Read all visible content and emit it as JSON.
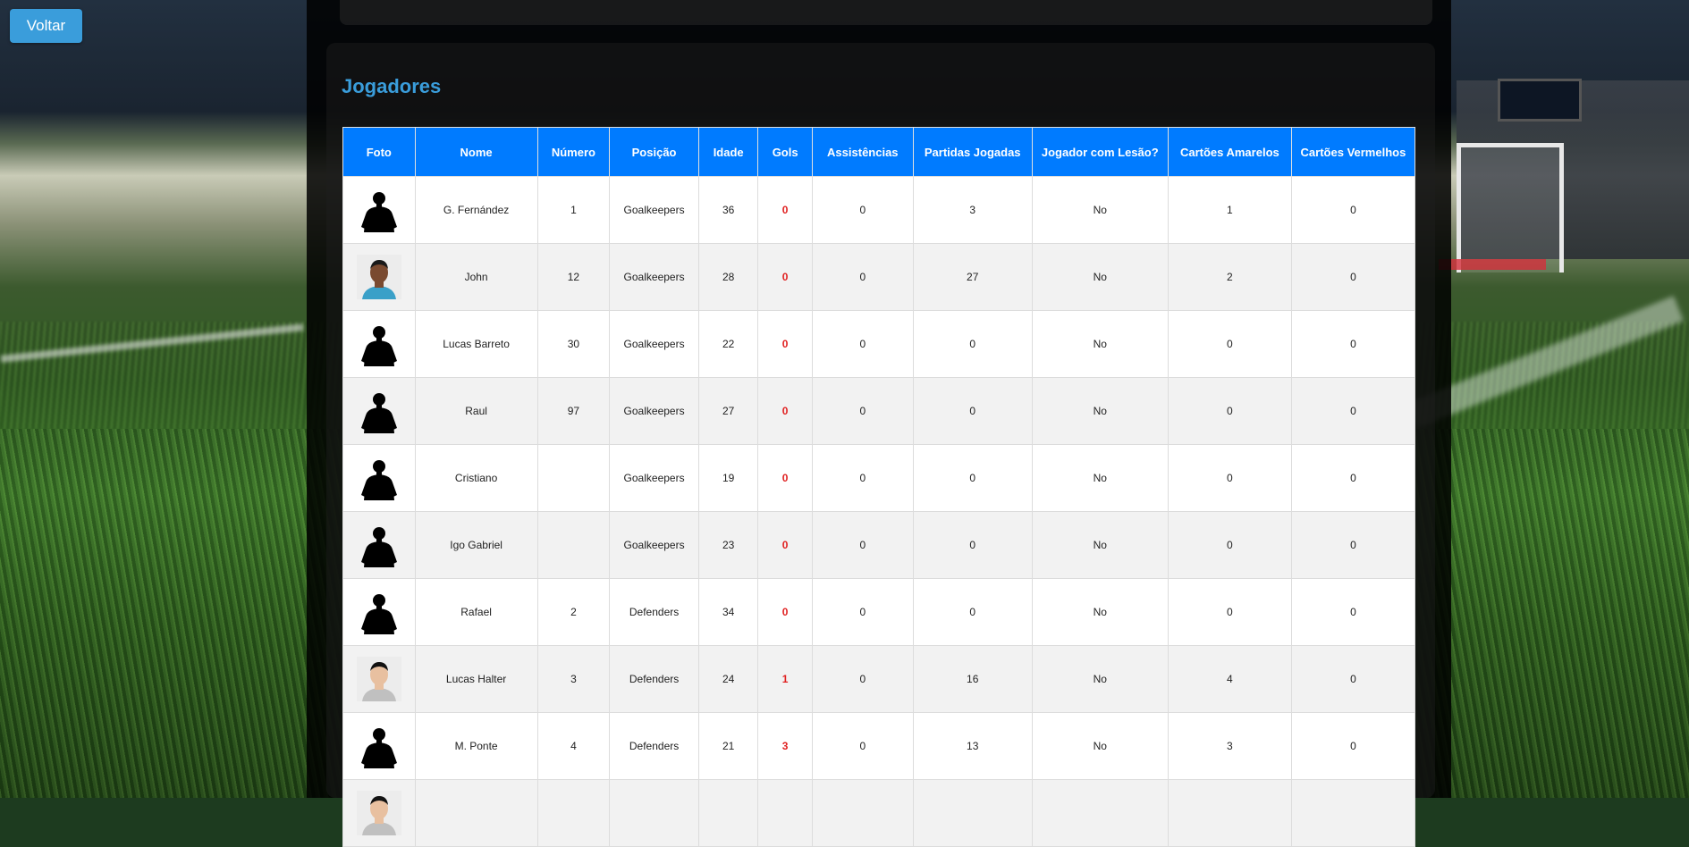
{
  "nav": {
    "back_label": "Voltar"
  },
  "page": {
    "title": "Jogadores"
  },
  "table": {
    "headers": {
      "foto": "Foto",
      "nome": "Nome",
      "numero": "Número",
      "posicao": "Posição",
      "idade": "Idade",
      "gols": "Gols",
      "assistencias": "Assistências",
      "partidas": "Partidas Jogadas",
      "lesao": "Jogador com Lesão?",
      "amarelos": "Cartões Amarelos",
      "vermelhos": "Cartões Vermelhos"
    },
    "rows": [
      {
        "photo": "silhouette",
        "nome": "G. Fernández",
        "numero": "1",
        "posicao": "Goalkeepers",
        "idade": "36",
        "gols": "0",
        "assistencias": "0",
        "partidas": "3",
        "lesao": "No",
        "amarelos": "1",
        "vermelhos": "0"
      },
      {
        "photo": "portrait-dark",
        "nome": "John",
        "numero": "12",
        "posicao": "Goalkeepers",
        "idade": "28",
        "gols": "0",
        "assistencias": "0",
        "partidas": "27",
        "lesao": "No",
        "amarelos": "2",
        "vermelhos": "0"
      },
      {
        "photo": "silhouette",
        "nome": "Lucas Barreto",
        "numero": "30",
        "posicao": "Goalkeepers",
        "idade": "22",
        "gols": "0",
        "assistencias": "0",
        "partidas": "0",
        "lesao": "No",
        "amarelos": "0",
        "vermelhos": "0"
      },
      {
        "photo": "silhouette",
        "nome": "Raul",
        "numero": "97",
        "posicao": "Goalkeepers",
        "idade": "27",
        "gols": "0",
        "assistencias": "0",
        "partidas": "0",
        "lesao": "No",
        "amarelos": "0",
        "vermelhos": "0"
      },
      {
        "photo": "silhouette",
        "nome": "Cristiano",
        "numero": "",
        "posicao": "Goalkeepers",
        "idade": "19",
        "gols": "0",
        "assistencias": "0",
        "partidas": "0",
        "lesao": "No",
        "amarelos": "0",
        "vermelhos": "0"
      },
      {
        "photo": "silhouette",
        "nome": "Igo Gabriel",
        "numero": "",
        "posicao": "Goalkeepers",
        "idade": "23",
        "gols": "0",
        "assistencias": "0",
        "partidas": "0",
        "lesao": "No",
        "amarelos": "0",
        "vermelhos": "0"
      },
      {
        "photo": "silhouette",
        "nome": "Rafael",
        "numero": "2",
        "posicao": "Defenders",
        "idade": "34",
        "gols": "0",
        "assistencias": "0",
        "partidas": "0",
        "lesao": "No",
        "amarelos": "0",
        "vermelhos": "0"
      },
      {
        "photo": "portrait-light",
        "nome": "Lucas Halter",
        "numero": "3",
        "posicao": "Defenders",
        "idade": "24",
        "gols": "1",
        "assistencias": "0",
        "partidas": "16",
        "lesao": "No",
        "amarelos": "4",
        "vermelhos": "0"
      },
      {
        "photo": "silhouette",
        "nome": "M. Ponte",
        "numero": "4",
        "posicao": "Defenders",
        "idade": "21",
        "gols": "3",
        "assistencias": "0",
        "partidas": "13",
        "lesao": "No",
        "amarelos": "3",
        "vermelhos": "0"
      },
      {
        "photo": "portrait-light",
        "nome": "",
        "numero": "",
        "posicao": "",
        "idade": "",
        "gols": "",
        "assistencias": "",
        "partidas": "",
        "lesao": "",
        "amarelos": "",
        "vermelhos": ""
      }
    ]
  }
}
